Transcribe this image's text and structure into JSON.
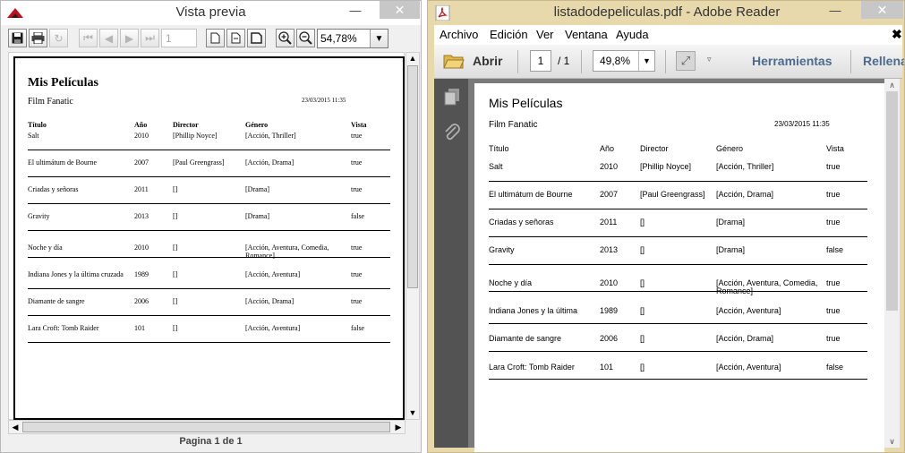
{
  "preview_window": {
    "title": "Vista previa",
    "zoom": "54,78%",
    "page_field": "1",
    "status": "Pagina 1 de 1",
    "icons": {
      "save": "💾",
      "print": "🖨",
      "refresh": "↻",
      "first": "⏮",
      "prev": "◀",
      "next": "▶",
      "last": "⏭",
      "page_single": "□",
      "page_width": "⌷",
      "page_fit": "⎓",
      "zoom_in": "⊕",
      "zoom_out": "⊖",
      "dropdown": "▼",
      "minimize": "—",
      "close": "✕",
      "scroll_up": "▲",
      "scroll_down": "▼",
      "scroll_left": "◀",
      "scroll_right": "▶",
      "grip_v": "≡",
      "grip_h": "|||"
    },
    "colors": {
      "window_bg": "#f0f0f0",
      "close_bg": "#c7c7c7",
      "logo_red": "#c0101b"
    }
  },
  "reader_window": {
    "title": "listadodepeliculas.pdf - Adobe Reader",
    "menu": [
      "Archivo",
      "Edición",
      "Ver",
      "Ventana",
      "Ayuda"
    ],
    "menu_close": "✖",
    "open_label": "Abrir",
    "page_current": "1",
    "page_total": "/ 1",
    "zoom": "49,8%",
    "tools_label": "Herramientas",
    "fill_label": "Rellenar",
    "icons": {
      "folder": "folder-icon",
      "pages": "pages-icon",
      "attach": "paperclip-icon",
      "expand": "⤢",
      "dropdown": "▼",
      "small_dropdown": "▿",
      "minimize": "—",
      "close": "✕",
      "scroll_up": "∧",
      "scroll_down": "∨"
    },
    "colors": {
      "chrome_bg": "#e8d9ad",
      "panel_bg": "#535353",
      "doc_bg": "#7a7a7a",
      "tool_text": "#4c6b8e"
    }
  },
  "report": {
    "title": "Mis Películas",
    "subtitle": "Film Fanatic",
    "date": "23/03/2015  11:35",
    "headers": [
      "Título",
      "Año",
      "Director",
      "Género",
      "Vista"
    ],
    "rows": [
      {
        "titulo": "Salt",
        "titulo_reader": "Salt",
        "anio": "2010",
        "director": "[Phillip Noyce]",
        "genero": "[Acción, Thriller]",
        "genero_l2": "",
        "vista": "true"
      },
      {
        "titulo": "El ultimátum de Bourne",
        "titulo_reader": "El ultimátum de Bourne",
        "anio": "2007",
        "director": "[Paul Greengrass]",
        "genero": "[Acción, Drama]",
        "genero_l2": "",
        "vista": "true"
      },
      {
        "titulo": "Criadas y señoras",
        "titulo_reader": "Criadas y señoras",
        "anio": "2011",
        "director": "[]",
        "genero": "[Drama]",
        "genero_l2": "",
        "vista": "true"
      },
      {
        "titulo": "Gravity",
        "titulo_reader": "Gravity",
        "anio": "2013",
        "director": "[]",
        "genero": "[Drama]",
        "genero_l2": "",
        "vista": "false"
      },
      {
        "titulo": "Noche y día",
        "titulo_reader": "Noche y día",
        "anio": "2010",
        "director": "[]",
        "genero": "[Acción, Aventura, Comedia,",
        "genero_l2": "Romance]",
        "vista": "true"
      },
      {
        "titulo": "Indiana Jones y la última cruzada",
        "titulo_reader": "Indiana Jones y la última",
        "anio": "1989",
        "director": "[]",
        "genero": "[Acción, Aventura]",
        "genero_l2": "",
        "vista": "true"
      },
      {
        "titulo": "Diamante de sangre",
        "titulo_reader": "Diamante de sangre",
        "anio": "2006",
        "director": "[]",
        "genero": "[Acción, Drama]",
        "genero_l2": "",
        "vista": "true"
      },
      {
        "titulo": "Lara Croft: Tomb Raider",
        "titulo_reader": "Lara Croft: Tomb Raider",
        "anio": "101",
        "director": "[]",
        "genero": "[Acción, Aventura]",
        "genero_l2": "",
        "vista": "false"
      }
    ]
  }
}
